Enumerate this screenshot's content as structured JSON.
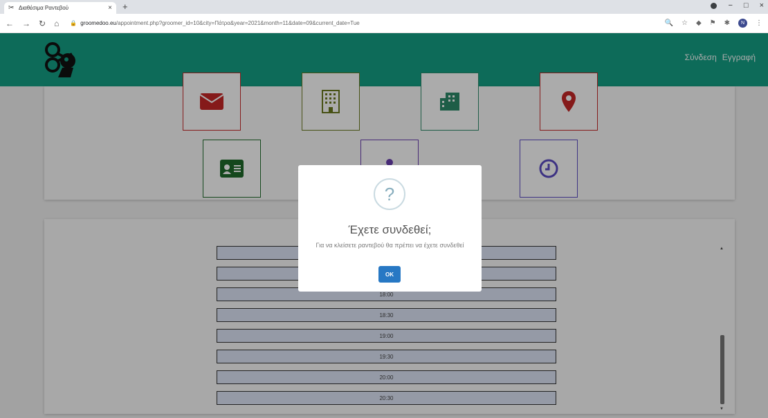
{
  "browser": {
    "tab_title": "Διαθέσιμα Ραντεβού",
    "tab_close": "×",
    "new_tab": "+",
    "url_host": "groomedoo.eu",
    "url_path": "/appointment.php?groomer_id=10&city=Πάτρα&year=2021&month=11&date=09&current_date=Tue",
    "profile_initial": "N"
  },
  "header": {
    "login_label": "Σύνδεση",
    "register_label": "Εγγραφή",
    "brand_color": "#14a085"
  },
  "info_icons": [
    {
      "icon": "envelope-icon",
      "color": "#c62828"
    },
    {
      "icon": "building-icon",
      "color": "#6a7a1f"
    },
    {
      "icon": "city-icon",
      "color": "#2e8b6b"
    },
    {
      "icon": "map-pin-icon",
      "color": "#c62828"
    },
    {
      "icon": "id-card-icon",
      "color": "#1e6b2a"
    },
    {
      "icon": "person-icon",
      "color": "#6a3fb0"
    },
    {
      "icon": "clock-icon",
      "color": "#5b4bc4"
    }
  ],
  "time_slots": [
    "18:00",
    "18:30",
    "19:00",
    "19:30",
    "20:00",
    "20:30"
  ],
  "modal": {
    "icon": "?",
    "title": "Έχετε συνδεθεί;",
    "text": "Για να κλείσετε ραντεβού θα πρέπει να έχετε συνδεθεί",
    "ok_label": "OK"
  }
}
